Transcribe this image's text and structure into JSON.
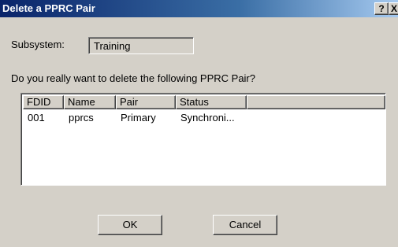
{
  "window": {
    "title": "Delete a PPRC Pair",
    "help_label": "?",
    "close_label": "X"
  },
  "subsystem": {
    "label": "Subsystem:",
    "value": "Training"
  },
  "question": "Do you really want to delete the following PPRC Pair?",
  "list": {
    "columns": [
      "FDID",
      "Name",
      "Pair",
      "Status",
      ""
    ],
    "rows": [
      [
        "001",
        "pprcs",
        "Primary",
        "Synchroni..."
      ]
    ]
  },
  "buttons": {
    "ok": "OK",
    "cancel": "Cancel"
  }
}
